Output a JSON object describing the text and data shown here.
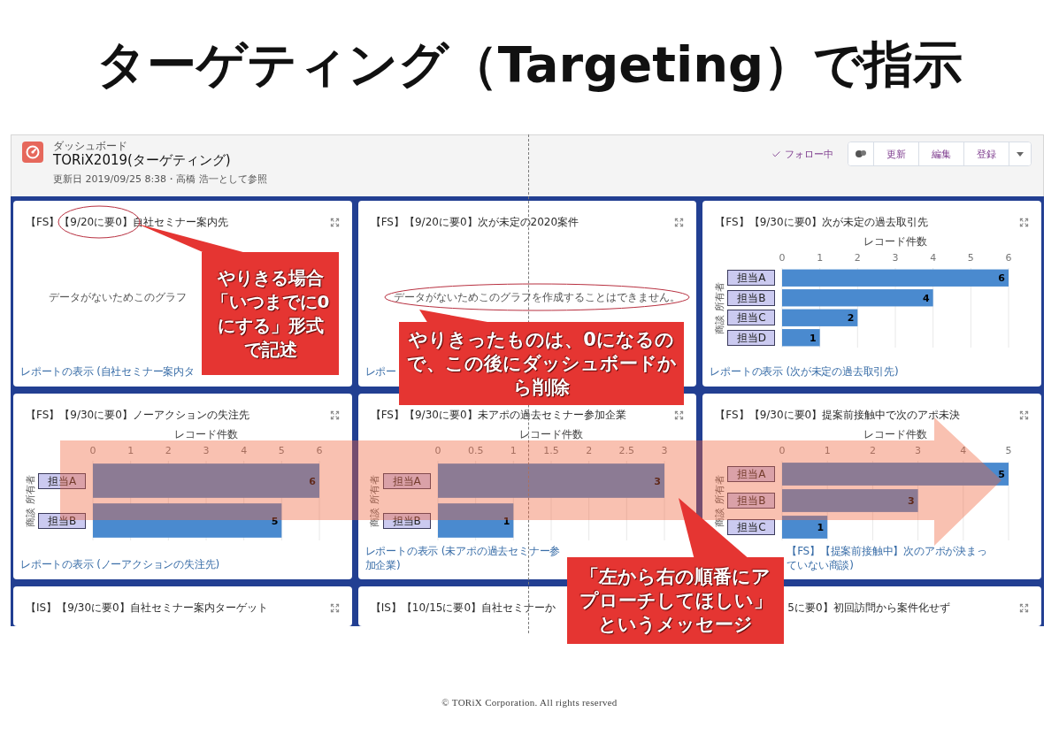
{
  "slide_title": "ターゲティング（Targeting）で指示",
  "dashboard": {
    "header": {
      "eyebrow": "ダッシュボード",
      "title": "TORiX2019(ターゲティング)",
      "updated": "更新日 2019/09/25 8:38・高橋 浩一として参照",
      "follow_label": "フォロー中",
      "buttons": [
        "更新",
        "編集",
        "登録"
      ]
    },
    "cards": [
      {
        "kind": "empty",
        "title": "【FS】【9/20に要0】自社セミナー案内先",
        "title_cut_start": false,
        "expand_icon": true,
        "message": "データがないためこのグラフ",
        "link": "レポートの表示 (自社セミナー案内タ",
        "link_cut_start": false
      },
      {
        "kind": "empty",
        "title": "【FS】【9/20に要0】次が未定の2020案件",
        "title_cut_start": false,
        "expand_icon": true,
        "message": "データがないためこのグラフを作成することはできません。",
        "link": "レポー",
        "link_cut_start": false
      },
      {
        "kind": "chart",
        "title": "【FS】【9/30に要0】次が未定の過去取引先",
        "title_cut_start": false,
        "expand_icon": true,
        "chart_data": {
          "type": "bar",
          "orientation": "horizontal",
          "xlabel": "レコード件数",
          "ylabel": "商談 所有者",
          "categories": [
            "担当A",
            "担当B",
            "担当C",
            "担当D"
          ],
          "values": [
            6,
            4,
            2,
            1
          ],
          "xlim": [
            0,
            6
          ],
          "xticks": [
            0,
            1,
            2,
            3,
            4,
            5,
            6
          ],
          "grid": true,
          "data_labels": true
        },
        "link": "レポートの表示 (次が未定の過去取引先)",
        "link_cut_start": false
      },
      {
        "kind": "chart",
        "title": "【FS】【9/30に要0】ノーアクションの失注先",
        "title_cut_start": false,
        "expand_icon": true,
        "chart_data": {
          "type": "bar",
          "orientation": "horizontal",
          "xlabel": "レコード件数",
          "ylabel": "商談 所有者",
          "categories": [
            "担当A",
            "担当B"
          ],
          "values": [
            6,
            5
          ],
          "xlim": [
            0,
            6
          ],
          "xticks": [
            0,
            1,
            2,
            3,
            4,
            5,
            6
          ],
          "grid": true,
          "data_labels": true
        },
        "link": "レポートの表示 (ノーアクションの失注先)",
        "link_cut_start": false
      },
      {
        "kind": "chart",
        "title": "【FS】【9/30に要0】未アポの過去セミナー参加企業",
        "title_cut_start": false,
        "expand_icon": true,
        "chart_data": {
          "type": "bar",
          "orientation": "horizontal",
          "xlabel": "レコード件数",
          "ylabel": "商談 所有者",
          "categories": [
            "担当A",
            "担当B"
          ],
          "values": [
            3,
            1
          ],
          "xlim": [
            0,
            3
          ],
          "xticks": [
            0,
            0.5,
            1,
            1.5,
            2,
            2.5,
            3
          ],
          "grid": true,
          "data_labels": true
        },
        "link": "レポートの表示 (未アポの過去セミナー参加企業)",
        "link_cut_start": false
      },
      {
        "kind": "chart",
        "title": "【FS】【9/30に要0】提案前接触中で次のアポ未決",
        "title_cut_start": false,
        "expand_icon": true,
        "chart_data": {
          "type": "bar",
          "orientation": "horizontal",
          "xlabel": "レコード件数",
          "ylabel": "商談 所有者",
          "categories": [
            "担当A",
            "担当B",
            "担当C"
          ],
          "values": [
            5,
            3,
            1
          ],
          "xlim": [
            0,
            5
          ],
          "xticks": [
            0,
            1,
            2,
            3,
            4,
            5
          ],
          "grid": true,
          "data_labels": true
        },
        "link": "【FS】【提案前接触中】次のアポが決まっていない商談)",
        "link_cut_start": true
      },
      {
        "kind": "title_only",
        "title": "【IS】【9/30に要0】自社セミナー案内ターゲット",
        "title_cut_start": false,
        "expand_icon": true
      },
      {
        "kind": "title_only",
        "title": "【IS】【10/15に要0】自社セミナーか",
        "title_cut_start": false,
        "expand_icon": false
      },
      {
        "kind": "title_only",
        "title": "5に要0】初回訪問から案件化せず",
        "title_cut_start": true,
        "expand_icon": true
      }
    ]
  },
  "callouts": [
    {
      "text": "やりきる場合「いつまでに0にする」形式で記述"
    },
    {
      "text": "やりきったものは、0になるので、この後にダッシュボードから削除"
    },
    {
      "text": "「左から右の順番にアプローチしてほしい」というメッセージ"
    }
  ],
  "footer": "© TORiX Corporation. All rights reserved"
}
